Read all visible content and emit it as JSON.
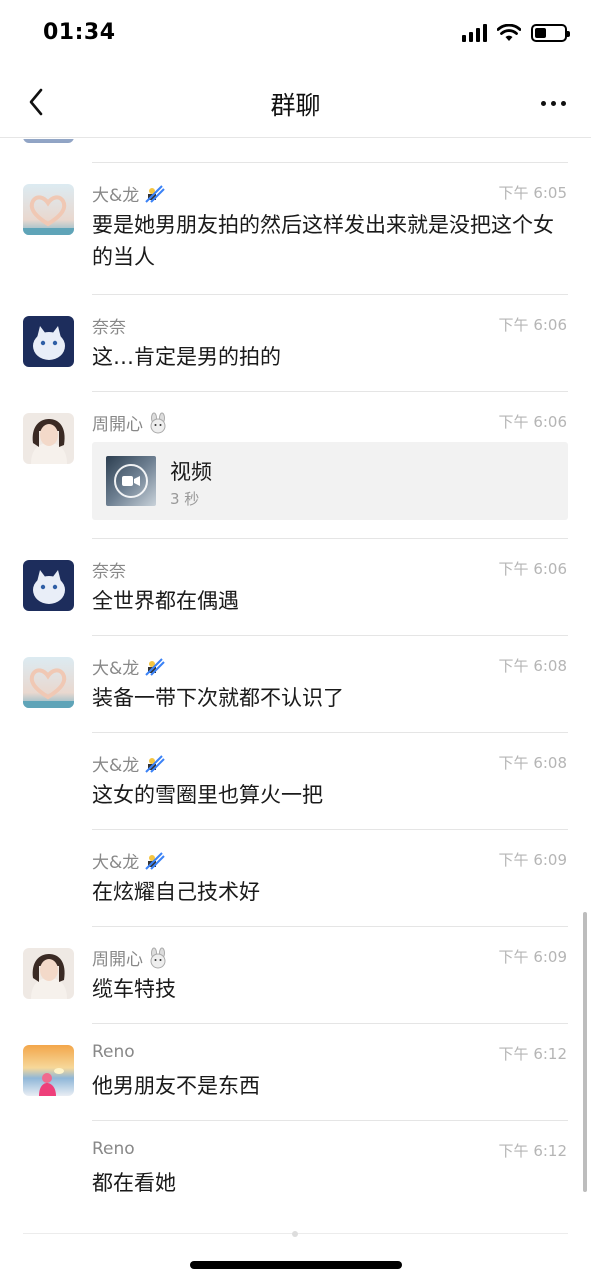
{
  "status_bar": {
    "time": "01:34"
  },
  "nav": {
    "title": "群聊",
    "back_icon": "chevron-left-icon",
    "more_icon": "more-dots-icon"
  },
  "messages": [
    {
      "sender": "大&龙",
      "badge": "skier-emoji",
      "time": "下午 6:05",
      "text": "要是她男朋友拍的然后这样发出来就是没把这个女的当人",
      "avatar": "hands-heart"
    },
    {
      "sender": "奈奈",
      "time": "下午 6:06",
      "text": "这…肯定是男的拍的",
      "avatar": "white-cat"
    },
    {
      "sender": "周開心",
      "badge": "rabbit-emoji",
      "time": "下午 6:06",
      "type": "video",
      "video_title": "视频",
      "video_duration": "3 秒",
      "avatar": "girl"
    },
    {
      "sender": "奈奈",
      "time": "下午 6:06",
      "text": "全世界都在偶遇",
      "avatar": "white-cat"
    },
    {
      "sender": "大&龙",
      "badge": "skier-emoji",
      "time": "下午 6:08",
      "text": "装备一带下次就都不认识了",
      "avatar": "hands-heart"
    },
    {
      "sender": "大&龙",
      "badge": "skier-emoji",
      "time": "下午 6:08",
      "text": "这女的雪圈里也算火一把"
    },
    {
      "sender": "大&龙",
      "badge": "skier-emoji",
      "time": "下午 6:09",
      "text": "在炫耀自己技术好"
    },
    {
      "sender": "周開心",
      "badge": "rabbit-emoji",
      "time": "下午 6:09",
      "text": "缆车特技",
      "avatar": "girl"
    },
    {
      "sender": "Reno",
      "time": "下午 6:12",
      "text": "他男朋友不是东西",
      "avatar": "sunset"
    },
    {
      "sender": "Reno",
      "time": "下午 6:12",
      "text": "都在看她"
    }
  ],
  "colors": {
    "meta_gray": "#888888",
    "time_gray": "#b5b5b5",
    "divider": "#e5e5e5"
  }
}
